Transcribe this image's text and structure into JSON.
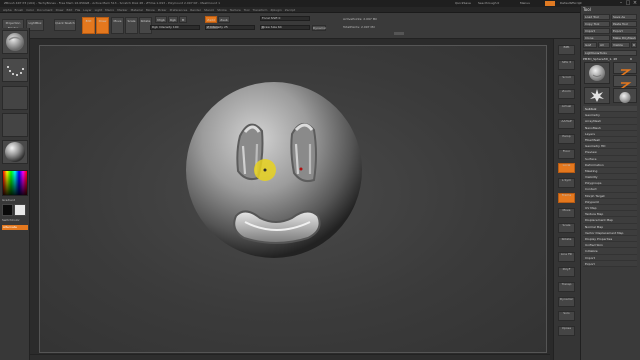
{
  "app": {
    "title": "ZBrush 4R7 P3 (x64) - TechyBones - Free Mem 16.656GB - Active Mem 513 - Scratch Disk 48 - ZTime 1.093 - PolyCount 2.097 KP - MeshCount 1",
    "quicksave_label": "QuickSave",
    "see_through_label": "See-through 0",
    "menus_label": "Menus",
    "default_zscript_label": "DefaultZScript"
  },
  "menubar": {
    "items": [
      "Alpha",
      "Brush",
      "Color",
      "Document",
      "Draw",
      "Edit",
      "File",
      "Layer",
      "Light",
      "Macro",
      "Marker",
      "Material",
      "Movie",
      "Picker",
      "Preferences",
      "Render",
      "Stencil",
      "Stroke",
      "Texture",
      "Tool",
      "Transform",
      "Zplugin",
      "Zscript"
    ]
  },
  "toolbar": {
    "lightbox_label": "LightBox",
    "projection_master_label": "Projection Master",
    "quick_sketch_label": "Quick Sketch",
    "edit_label": "Edit",
    "draw_label": "Draw",
    "move_label": "Move",
    "scale_label": "Scale",
    "rotate_label": "Rotate",
    "mrgb_label": "Mrgb",
    "rgb_label": "Rgb",
    "m_label": "M",
    "rgb_intensity_label": "Rgb Intensity 100",
    "zadd_label": "Zadd",
    "zsub_label": "Zsub",
    "z_intensity_label": "Z Intensity 25",
    "z_intensity_value": 0.25,
    "focal_shift_label": "Focal Shift 0",
    "draw_size_label": "Draw Size 64",
    "draw_size_value": 0.06,
    "dynamic_label": "Dynamic",
    "active_points_label": "ActivePoints: 2.097 Mil",
    "total_points_label": "TotalPoints: 2.097 Mil"
  },
  "left_shelf": {
    "brush_label": "Standard",
    "stroke_label": "DragDot",
    "alpha_label": "Alpha Off",
    "texture_label": "Texture Off",
    "material_label": "MatCap Gray",
    "gradient_label": "Gradient",
    "switch_color_label": "SwitchColor",
    "alternate_label": "Alternate"
  },
  "right_shelf": {
    "buttons": [
      "BPR",
      "SPix 3",
      "Scroll",
      "Zoom",
      "Actual",
      "AAHalf",
      "Persp",
      "Floor",
      "Local",
      "L.Sym",
      "Frame",
      "Move",
      "Scale",
      "Rotate",
      "Line Fill",
      "PolyF",
      "Transp",
      "Dynamic",
      "Solo",
      "Xpose"
    ]
  },
  "tool_palette": {
    "title": "Tool",
    "load_tool_label": "Load Tool",
    "save_as_label": "Save As",
    "copy_tool_label": "Copy Tool",
    "paste_tool_label": "Paste Tool",
    "import_label": "Import",
    "export_label": "Export",
    "clone_label": "Clone",
    "make_polymesh_label": "Make PolyMesh3D",
    "goz_label": "GoZ",
    "all_label": "All",
    "visible_label": "Visible",
    "r_label": "R",
    "lightbox_tools_label": "Lightbox▸Tools",
    "current_tool_label": "PM3D_Sphere3D_1. 48",
    "r2_label": "R",
    "tool_thumbs": [
      "PM3D_Sphere3D",
      "Cylinder3D",
      "PolyMesh3D",
      "SimpleBrush",
      "PM3D_Sphere3D"
    ],
    "subpalettes": [
      "Subtool",
      "Geometry",
      "ArrayMesh",
      "NanoMesh",
      "Layers",
      "FiberMesh",
      "Geometry HD",
      "Preview",
      "Surface",
      "Deformation",
      "Masking",
      "Visibility",
      "Polygroups",
      "Contact",
      "Morph Target",
      "Polypaint",
      "UV Map",
      "Texture Map",
      "Displacement Map",
      "Normal Map",
      "Vector Displacement Map",
      "Display Properties",
      "Unified Skin",
      "Initialize",
      "Import",
      "Export"
    ]
  },
  "colors": {
    "accent": "#e4781e",
    "background": "#2a2a2a",
    "panel": "#3a3a3a"
  }
}
